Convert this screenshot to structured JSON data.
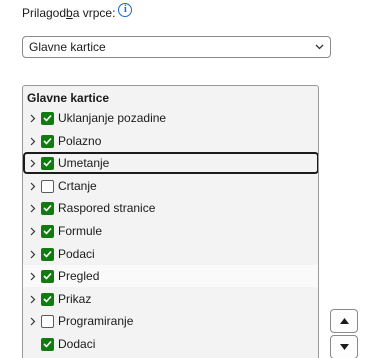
{
  "customize_ribbon": {
    "label_prefix": "Prilagod",
    "label_accel": "b",
    "label_suffix": "a vrpce:",
    "info_icon": "info-icon",
    "dropdown_value": "Glavne kartice"
  },
  "tree": {
    "header": "Glavne kartice",
    "items": [
      {
        "label": "Uklanjanje pozadine",
        "checked": true,
        "expander": true
      },
      {
        "label": "Polazno",
        "checked": true,
        "expander": true
      },
      {
        "label": "Umetanje",
        "checked": true,
        "expander": true,
        "focused": true
      },
      {
        "label": "Crtanje",
        "checked": false,
        "expander": true
      },
      {
        "label": "Raspored stranice",
        "checked": true,
        "expander": true
      },
      {
        "label": "Formule",
        "checked": true,
        "expander": true
      },
      {
        "label": "Podaci",
        "checked": true,
        "expander": true
      },
      {
        "label": "Pregled",
        "checked": true,
        "expander": true,
        "hovered": true
      },
      {
        "label": "Prikaz",
        "checked": true,
        "expander": true
      },
      {
        "label": "Programiranje",
        "checked": false,
        "expander": true
      },
      {
        "label": "Dodaci",
        "checked": true,
        "expander": false
      }
    ]
  },
  "buttons": {
    "move_up_icon": "triangle-up-icon",
    "move_down_icon": "triangle-down-icon"
  },
  "colors": {
    "checkbox_checked": "#107c10",
    "info_accent": "#1a66c9",
    "tree_background": "#f3f3f3"
  }
}
